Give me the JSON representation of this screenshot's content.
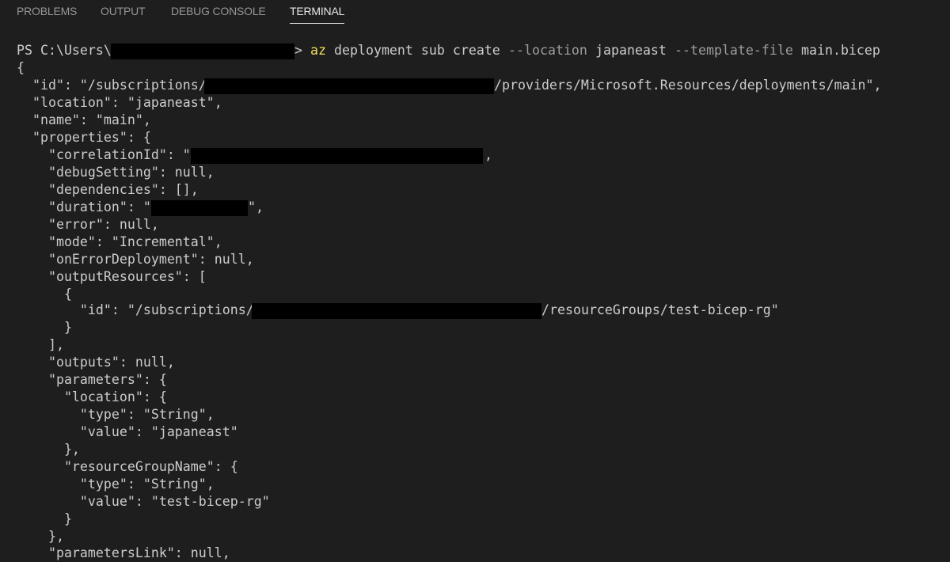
{
  "tabs": [
    {
      "label": "PROBLEMS",
      "active": false
    },
    {
      "label": "OUTPUT",
      "active": false
    },
    {
      "label": "DEBUG CONSOLE",
      "active": false
    },
    {
      "label": "TERMINAL",
      "active": true
    }
  ],
  "colors": {
    "background": "#1e1e1e",
    "text": "#cccccc",
    "command_keyword": "#f0e05a",
    "flag": "#9d9d9d",
    "redaction": "#000000"
  },
  "prompt": {
    "prefix": "PS C:\\Users\\",
    "suffix": ">",
    "cmd_az": "az",
    "cmd_args": "deployment sub create",
    "flag_location": "--location",
    "location_value": "japaneast",
    "flag_template": "--template-file",
    "template_value": "main.bicep"
  },
  "output": {
    "l1": "{",
    "l2a": "  \"id\": \"/subscriptions/",
    "l2b": "/providers/Microsoft.Resources/deployments/main\",",
    "l3": "  \"location\": \"japaneast\",",
    "l4": "  \"name\": \"main\",",
    "l5": "  \"properties\": {",
    "l6a": "    \"correlationId\": \"",
    "l6b": ",",
    "l7": "    \"debugSetting\": null,",
    "l8": "    \"dependencies\": [],",
    "l9a": "    \"duration\": \"",
    "l9b": "\",",
    "l10": "    \"error\": null,",
    "l11": "    \"mode\": \"Incremental\",",
    "l12": "    \"onErrorDeployment\": null,",
    "l13": "    \"outputResources\": [",
    "l14": "      {",
    "l15a": "        \"id\": \"/subscriptions/",
    "l15b": "/resourceGroups/test-bicep-rg\"",
    "l16": "      }",
    "l17": "    ],",
    "l18": "    \"outputs\": null,",
    "l19": "    \"parameters\": {",
    "l20": "      \"location\": {",
    "l21": "        \"type\": \"String\",",
    "l22": "        \"value\": \"japaneast\"",
    "l23": "      },",
    "l24": "      \"resourceGroupName\": {",
    "l25": "        \"type\": \"String\",",
    "l26": "        \"value\": \"test-bicep-rg\"",
    "l27": "      }",
    "l28": "    },",
    "l29": "    \"parametersLink\": null,"
  }
}
